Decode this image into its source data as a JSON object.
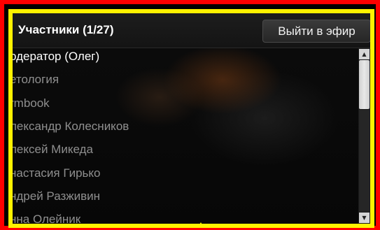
{
  "panel": {
    "title": "Участники (1/27)",
    "on_air_button": "Выйти в эфир"
  },
  "participants": [
    {
      "name": "одератор (Олег)",
      "color": "#ffffff"
    },
    {
      "name": "етология",
      "color": "#8f8f8f"
    },
    {
      "name": "rmbook",
      "color": "#8f8f8f"
    },
    {
      "name": "лександр Колесников",
      "color": "#8f8f8f"
    },
    {
      "name": "лексей Микеда",
      "color": "#8f8f8f"
    },
    {
      "name": "настасия Гирько",
      "color": "#8f8f8f"
    },
    {
      "name": "ндрей Разживин",
      "color": "#8f8f8f"
    },
    {
      "name": "нна Олейник",
      "color": "#8f8f8f"
    }
  ],
  "colors": {
    "highlight_border": "#fff200",
    "outer_frame": "#fe0000"
  }
}
